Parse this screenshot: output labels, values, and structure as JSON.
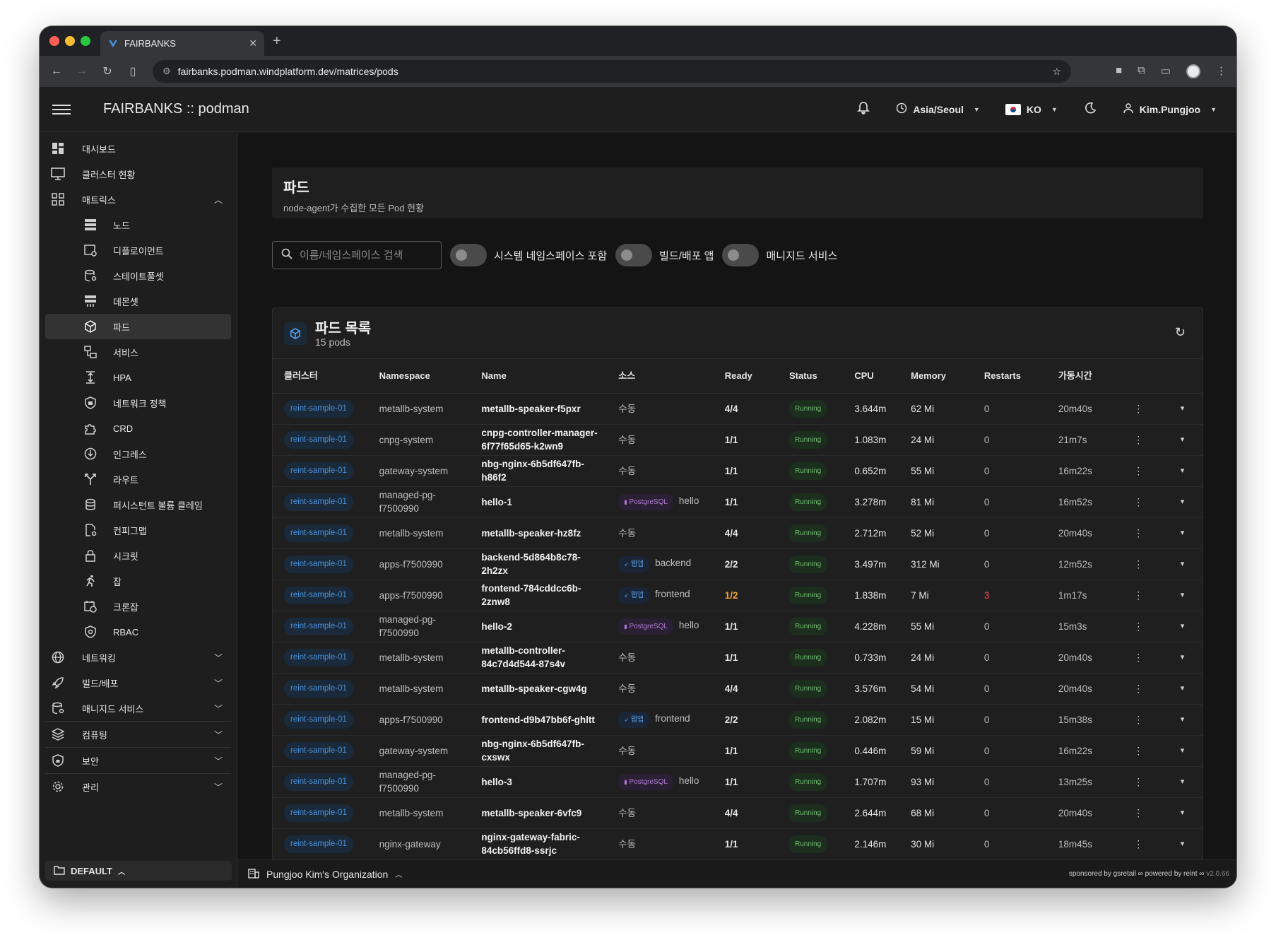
{
  "browser": {
    "tab_title": "FAIRBANKS",
    "url": "fairbanks.podman.windplatform.dev/matrices/pods"
  },
  "header": {
    "title": "FAIRBANKS :: podman",
    "timezone": "Asia/Seoul",
    "language": "KO",
    "user": "Kim.Pungjoo"
  },
  "sidebar": {
    "items": [
      {
        "label": "대시보드",
        "icon": "dashboard-icon"
      },
      {
        "label": "클러스터 현황",
        "icon": "monitor-icon"
      },
      {
        "label": "매트릭스",
        "icon": "grid-icon"
      }
    ],
    "matrix_items": [
      {
        "label": "노드",
        "icon": "server-icon"
      },
      {
        "label": "디플로이먼트",
        "icon": "deployment-icon"
      },
      {
        "label": "스테이트풀셋",
        "icon": "database-gear-icon"
      },
      {
        "label": "데몬셋",
        "icon": "daemonset-icon"
      },
      {
        "label": "파드",
        "icon": "cube-icon"
      },
      {
        "label": "서비스",
        "icon": "service-icon"
      },
      {
        "label": "HPA",
        "icon": "scale-icon"
      },
      {
        "label": "네트워크 정책",
        "icon": "shield-icon"
      },
      {
        "label": "CRD",
        "icon": "puzzle-icon"
      },
      {
        "label": "인그레스",
        "icon": "download-circle-icon"
      },
      {
        "label": "라우트",
        "icon": "route-icon"
      },
      {
        "label": "퍼시스턴트 볼륨 클레임",
        "icon": "database-icon"
      },
      {
        "label": "컨피그맵",
        "icon": "file-gear-icon"
      },
      {
        "label": "시크릿",
        "icon": "lock-icon"
      },
      {
        "label": "잡",
        "icon": "run-icon"
      },
      {
        "label": "크론잡",
        "icon": "calendar-clock-icon"
      },
      {
        "label": "RBAC",
        "icon": "shield-gear-icon"
      }
    ],
    "groups": [
      {
        "label": "네트워킹",
        "icon": "globe-icon"
      },
      {
        "label": "빌드/배포",
        "icon": "rocket-icon"
      },
      {
        "label": "매니지드 서비스",
        "icon": "database-gear-icon"
      },
      {
        "label": "컴퓨팅",
        "icon": "layers-icon"
      },
      {
        "label": "보안",
        "icon": "shield-lock-icon"
      },
      {
        "label": "관리",
        "icon": "gear-icon"
      }
    ],
    "footer": "DEFAULT"
  },
  "page": {
    "title": "파드",
    "subtitle": "node-agent가 수집한 모든 Pod 현황"
  },
  "filters": {
    "search_placeholder": "이름/네임스페이스 검색",
    "toggle_system": "시스템 네임스페이스 포함",
    "toggle_build": "빌드/배포 앱",
    "toggle_managed": "매니지드 서비스"
  },
  "card": {
    "title": "파드 목록",
    "count": "15 pods"
  },
  "table": {
    "headers": [
      "클러스터",
      "Namespace",
      "Name",
      "소스",
      "Ready",
      "Status",
      "CPU",
      "Memory",
      "Restarts",
      "가동시간"
    ],
    "rows": [
      {
        "cluster": "reint-sample-01",
        "ns": "metallb-system",
        "name": "metallb-speaker-f5pxr",
        "src_badge": "",
        "src": "수동",
        "ready": "4/4",
        "status": "Running",
        "cpu": "3.644m",
        "mem": "62 Mi",
        "restarts": "0",
        "uptime": "20m40s"
      },
      {
        "cluster": "reint-sample-01",
        "ns": "cnpg-system",
        "name": "cnpg-controller-manager-6f77f65d65-k2wn9",
        "src_badge": "",
        "src": "수동",
        "ready": "1/1",
        "status": "Running",
        "cpu": "1.083m",
        "mem": "24 Mi",
        "restarts": "0",
        "uptime": "21m7s"
      },
      {
        "cluster": "reint-sample-01",
        "ns": "gateway-system",
        "name": "nbg-nginx-6b5df647fb-h86f2",
        "src_badge": "",
        "src": "수동",
        "ready": "1/1",
        "status": "Running",
        "cpu": "0.652m",
        "mem": "55 Mi",
        "restarts": "0",
        "uptime": "16m22s"
      },
      {
        "cluster": "reint-sample-01",
        "ns": "managed-pg-f7500990",
        "name": "hello-1",
        "src_badge": "PostgreSQL",
        "src_kind": "pg",
        "src": "hello",
        "ready": "1/1",
        "status": "Running",
        "cpu": "3.278m",
        "mem": "81 Mi",
        "restarts": "0",
        "uptime": "16m52s"
      },
      {
        "cluster": "reint-sample-01",
        "ns": "metallb-system",
        "name": "metallb-speaker-hz8fz",
        "src_badge": "",
        "src": "수동",
        "ready": "4/4",
        "status": "Running",
        "cpu": "2.712m",
        "mem": "52 Mi",
        "restarts": "0",
        "uptime": "20m40s"
      },
      {
        "cluster": "reint-sample-01",
        "ns": "apps-f7500990",
        "name": "backend-5d864b8c78-2h2zx",
        "src_badge": "웹앱",
        "src_kind": "web",
        "src": "backend",
        "ready": "2/2",
        "status": "Running",
        "cpu": "3.497m",
        "mem": "312 Mi",
        "restarts": "0",
        "uptime": "12m52s"
      },
      {
        "cluster": "reint-sample-01",
        "ns": "apps-f7500990",
        "name": "frontend-784cddcc6b-2znw8",
        "src_badge": "웹앱",
        "src_kind": "web",
        "src": "frontend",
        "ready": "1/2",
        "ready_warn": true,
        "status": "Running",
        "cpu": "1.838m",
        "mem": "7 Mi",
        "restarts": "3",
        "restarts_warn": true,
        "uptime": "1m17s"
      },
      {
        "cluster": "reint-sample-01",
        "ns": "managed-pg-f7500990",
        "name": "hello-2",
        "src_badge": "PostgreSQL",
        "src_kind": "pg",
        "src": "hello",
        "ready": "1/1",
        "status": "Running",
        "cpu": "4.228m",
        "mem": "55 Mi",
        "restarts": "0",
        "uptime": "15m3s"
      },
      {
        "cluster": "reint-sample-01",
        "ns": "metallb-system",
        "name": "metallb-controller-84c7d4d544-87s4v",
        "src_badge": "",
        "src": "수동",
        "ready": "1/1",
        "status": "Running",
        "cpu": "0.733m",
        "mem": "24 Mi",
        "restarts": "0",
        "uptime": "20m40s"
      },
      {
        "cluster": "reint-sample-01",
        "ns": "metallb-system",
        "name": "metallb-speaker-cgw4g",
        "src_badge": "",
        "src": "수동",
        "ready": "4/4",
        "status": "Running",
        "cpu": "3.576m",
        "mem": "54 Mi",
        "restarts": "0",
        "uptime": "20m40s"
      },
      {
        "cluster": "reint-sample-01",
        "ns": "apps-f7500990",
        "name": "frontend-d9b47bb6f-ghltt",
        "src_badge": "웹앱",
        "src_kind": "web",
        "src": "frontend",
        "ready": "2/2",
        "status": "Running",
        "cpu": "2.082m",
        "mem": "15 Mi",
        "restarts": "0",
        "uptime": "15m38s"
      },
      {
        "cluster": "reint-sample-01",
        "ns": "gateway-system",
        "name": "nbg-nginx-6b5df647fb-cxswx",
        "src_badge": "",
        "src": "수동",
        "ready": "1/1",
        "status": "Running",
        "cpu": "0.446m",
        "mem": "59 Mi",
        "restarts": "0",
        "uptime": "16m22s"
      },
      {
        "cluster": "reint-sample-01",
        "ns": "managed-pg-f7500990",
        "name": "hello-3",
        "src_badge": "PostgreSQL",
        "src_kind": "pg",
        "src": "hello",
        "ready": "1/1",
        "status": "Running",
        "cpu": "1.707m",
        "mem": "93 Mi",
        "restarts": "0",
        "uptime": "13m25s"
      },
      {
        "cluster": "reint-sample-01",
        "ns": "metallb-system",
        "name": "metallb-speaker-6vfc9",
        "src_badge": "",
        "src": "수동",
        "ready": "4/4",
        "status": "Running",
        "cpu": "2.644m",
        "mem": "68 Mi",
        "restarts": "0",
        "uptime": "20m40s"
      },
      {
        "cluster": "reint-sample-01",
        "ns": "nginx-gateway",
        "name": "nginx-gateway-fabric-84cb56ffd8-ssrjc",
        "src_badge": "",
        "src": "수동",
        "ready": "1/1",
        "status": "Running",
        "cpu": "2.146m",
        "mem": "30 Mi",
        "restarts": "0",
        "uptime": "18m45s"
      }
    ]
  },
  "footer": {
    "org": "Pungjoo Kim's Organization",
    "credit": "sponsored by gsretail ∞ powered by reint ∞",
    "version": "v2.0.66"
  },
  "colors": {
    "accent": "#4a90d9",
    "running": "#6ebf6e",
    "warning": "#f0a030",
    "error": "#f05050"
  }
}
